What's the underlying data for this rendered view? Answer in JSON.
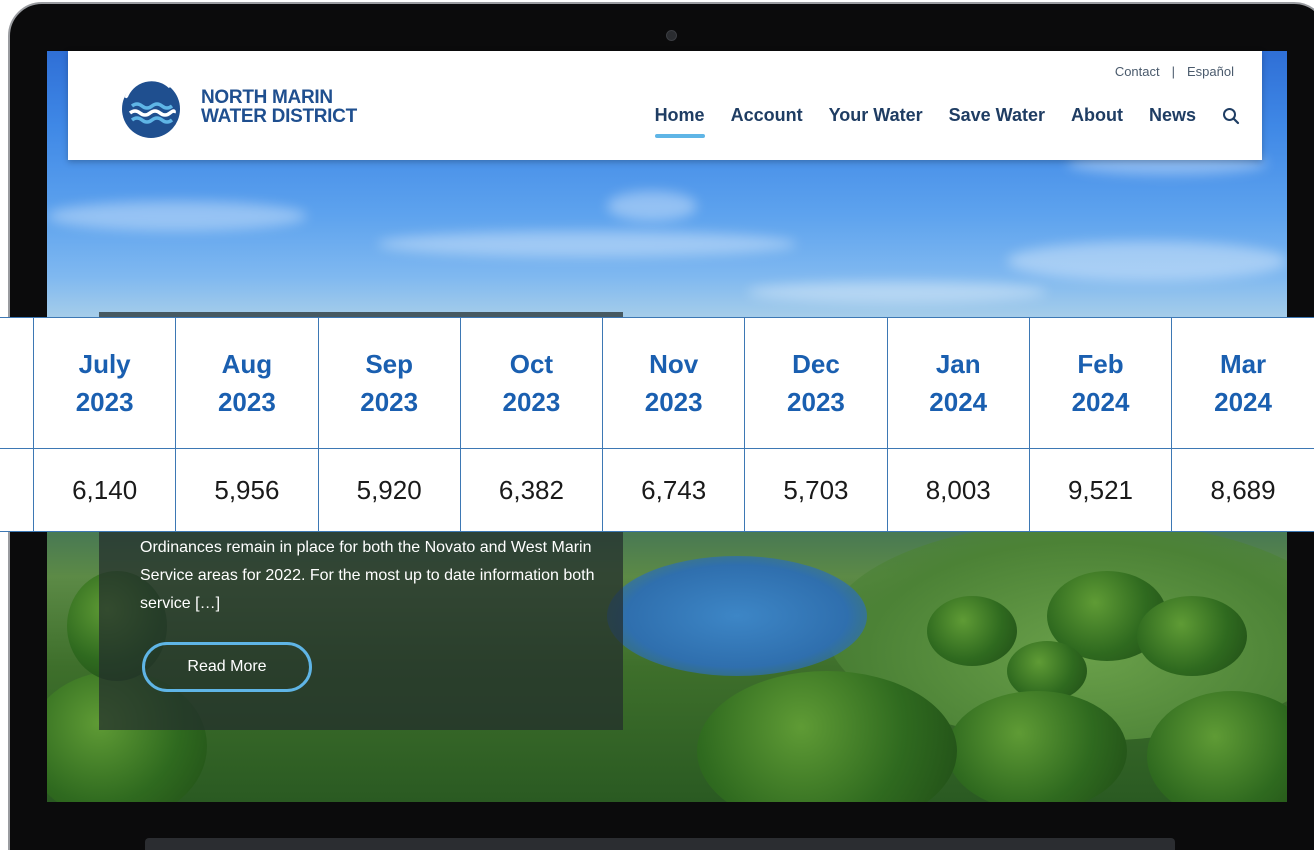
{
  "header": {
    "logo_line1": "NORTH MARIN",
    "logo_line2": "WATER DISTRICT",
    "utility_links": [
      "Contact",
      "Español"
    ],
    "separator": "|",
    "nav": [
      "Home",
      "Account",
      "Your Water",
      "Save Water",
      "About",
      "News"
    ],
    "active_nav": "Home",
    "search_icon": "search-icon"
  },
  "card": {
    "text": "Ordinances remain in place for both the Novato and West Marin Service areas for 2022.   For the most up to date information both service […]",
    "button_label": "Read More"
  },
  "table": {
    "months": [
      {
        "line1": "July",
        "line2": "2023"
      },
      {
        "line1": "Aug",
        "line2": "2023"
      },
      {
        "line1": "Sep",
        "line2": "2023"
      },
      {
        "line1": "Oct",
        "line2": "2023"
      },
      {
        "line1": "Nov",
        "line2": "2023"
      },
      {
        "line1": "Dec",
        "line2": "2023"
      },
      {
        "line1": "Jan",
        "line2": "2024"
      },
      {
        "line1": "Feb",
        "line2": "2024"
      },
      {
        "line1": "Mar",
        "line2": "2024"
      }
    ],
    "values": [
      "6,140",
      "5,956",
      "5,920",
      "6,382",
      "6,743",
      "5,703",
      "8,003",
      "9,521",
      "8,689"
    ]
  },
  "colors": {
    "brand_blue": "#1f4f8f",
    "accent_light_blue": "#5fb5e6",
    "table_header_blue": "#1a5fb0",
    "table_border": "#3d78b4"
  }
}
